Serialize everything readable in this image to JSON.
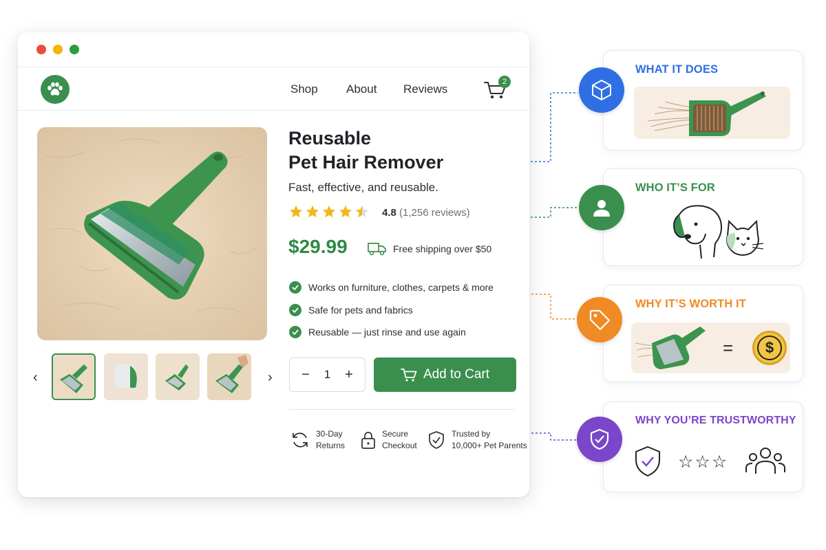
{
  "window": {
    "traffic_lights": [
      "close",
      "minimize",
      "maximize"
    ]
  },
  "nav": {
    "logo_icon": "paw-icon",
    "links": [
      "Shop",
      "About",
      "Reviews"
    ],
    "cart_count": "2"
  },
  "product": {
    "title_line1": "Reusable",
    "title_line2": "Pet Hair Remover",
    "subtitle": "Fast, effective, and reusable.",
    "rating_value": "4.8",
    "rating_stars": 4.5,
    "reviews": "(1,256 reviews)",
    "price": "$29.99",
    "shipping": "Free shipping over $50",
    "bullets": [
      "Works on furniture, clothes, carpets & more",
      "Safe for pets and fabrics",
      "Reusable — just rinse and use again"
    ],
    "quantity": "1",
    "add_to_cart": "Add to Cart",
    "trust_badges": [
      {
        "line1": "30-Day",
        "line2": "Returns",
        "icon": "refresh-icon"
      },
      {
        "line1": "Secure",
        "line2": "Checkout",
        "icon": "lock-icon"
      },
      {
        "line1": "Trusted by",
        "line2": "10,000+ Pet Parents",
        "icon": "shield-check-icon"
      }
    ]
  },
  "callouts": [
    {
      "title": "WHAT IT DOES",
      "color": "#2f6fe4",
      "icon": "box-icon"
    },
    {
      "title": "WHO IT’S FOR",
      "color": "#3a8f4f",
      "icon": "person-icon"
    },
    {
      "title": "WHY IT’S WORTH IT",
      "color": "#f08a24",
      "icon": "tag-icon"
    },
    {
      "title": "WHY YOU’RE TRUSTWORTHY",
      "color": "#7b46c9",
      "icon": "shield-check-icon"
    }
  ],
  "colors": {
    "brand_green": "#3a8f4f",
    "price_green": "#2f8a45",
    "text": "#1f2328"
  }
}
